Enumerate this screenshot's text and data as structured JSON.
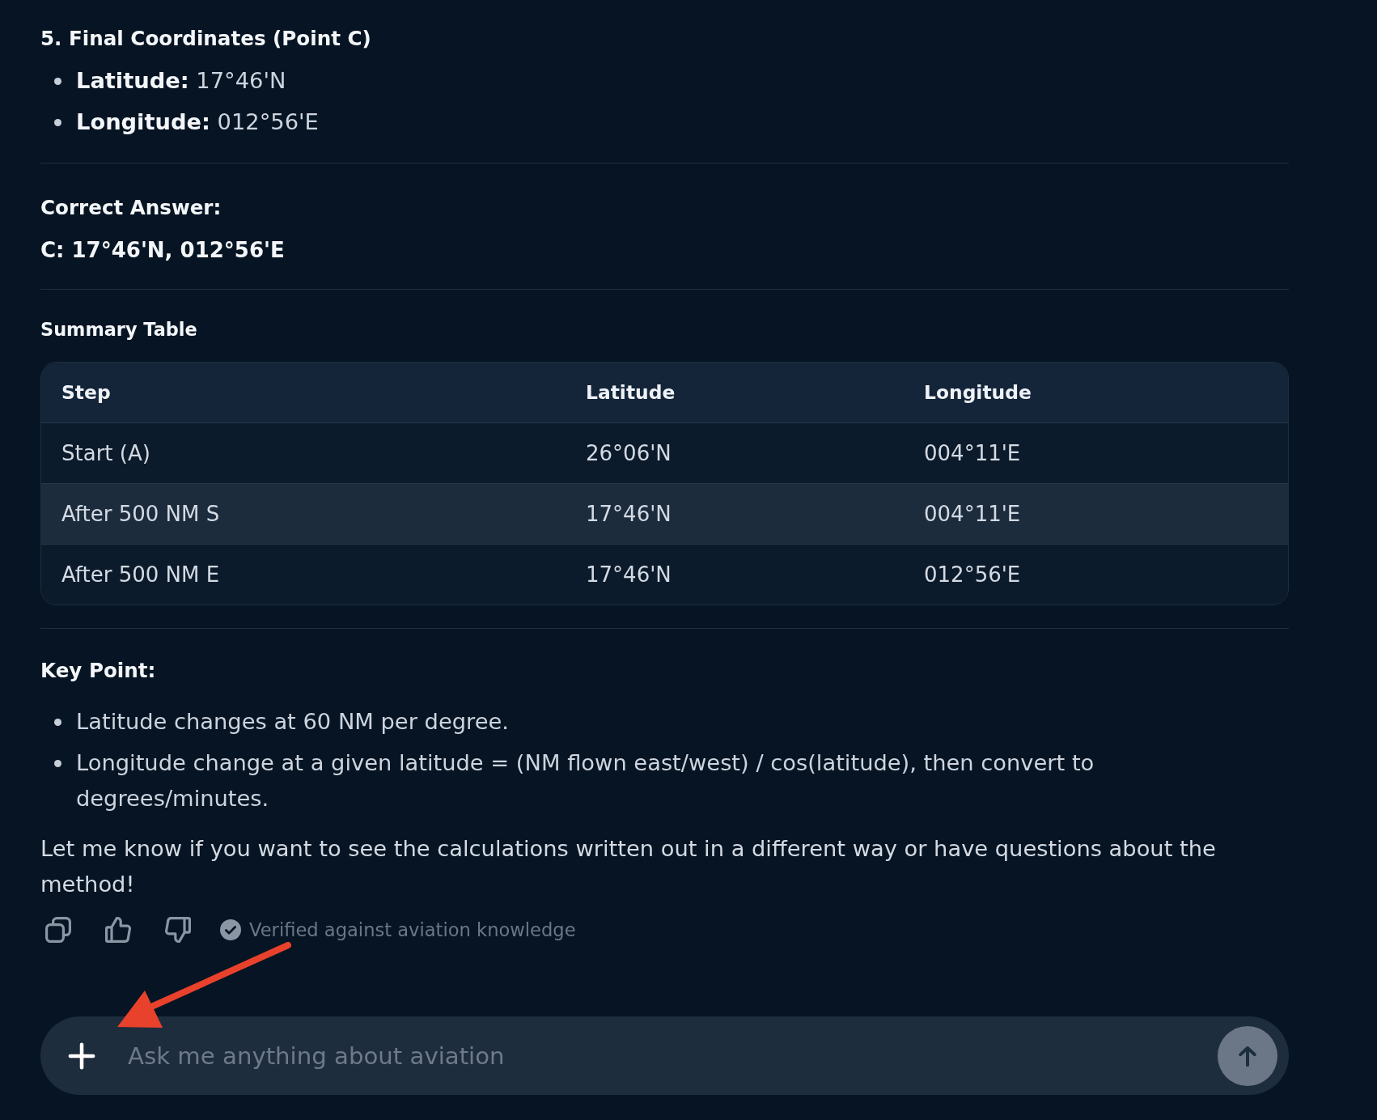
{
  "final_coordinates": {
    "heading": "5. Final Coordinates (Point C)",
    "items": [
      "**Latitude:** 17°46'N",
      "**Longitude:** 012°56'E"
    ]
  },
  "correct_answer": {
    "heading": "Correct Answer:",
    "answer": "C: 17°46'N, 012°56'E"
  },
  "summary_table": {
    "title": "Summary Table",
    "columns": [
      "Step",
      "Latitude",
      "Longitude"
    ],
    "rows": [
      [
        "Start (A)",
        "26°06'N",
        "004°11'E"
      ],
      [
        "After 500 NM S",
        "17°46'N",
        "004°11'E"
      ],
      [
        "After 500 NM E",
        "17°46'N",
        "012°56'E"
      ]
    ]
  },
  "key_point": {
    "heading": "Key Point:",
    "items": [
      "Latitude changes at 60 NM per degree.",
      "Longitude change at a given latitude = (NM flown east/west) / cos(latitude), then convert to degrees/minutes."
    ]
  },
  "closing_message": "Let me know if you want to see the calculations written out in a different way or have questions about the method!",
  "actions": {
    "verified_label": "Verified against aviation knowledge"
  },
  "composer": {
    "placeholder": "Ask me anything about aviation"
  },
  "annotations": [
    {
      "kind": "arrow"
    }
  ]
}
